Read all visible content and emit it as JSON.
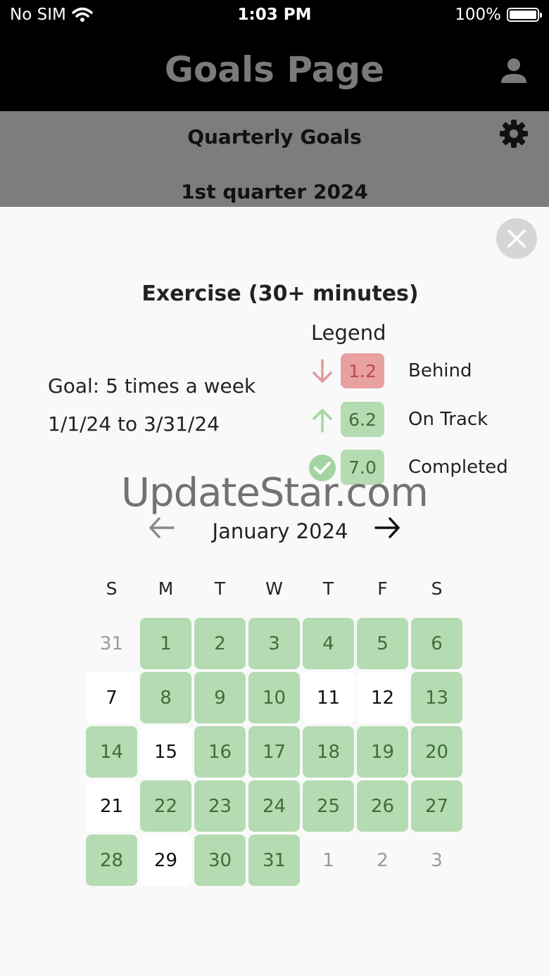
{
  "status_bar": {
    "carrier": "No SIM",
    "time": "1:03 PM",
    "battery": "100%"
  },
  "app_bar": {
    "title": "Goals Page",
    "profile_icon": "person-icon"
  },
  "background": {
    "title": "Quarterly Goals",
    "subtitle": "1st quarter 2024",
    "settings_icon": "gear-icon"
  },
  "sheet": {
    "title": "Exercise (30+ minutes)",
    "goal_text": "Goal: 5 times a week",
    "date_range": "1/1/24 to 3/31/24",
    "legend": {
      "title": "Legend",
      "items": [
        {
          "icon": "arrow-down-icon",
          "value": "1.2",
          "label": "Behind",
          "box_color": "#e8a0a0",
          "text_color": "#b94a4a",
          "icon_color": "#e39a9a"
        },
        {
          "icon": "arrow-up-icon",
          "value": "6.2",
          "label": "On Track",
          "box_color": "#b4dbb1",
          "text_color": "#3f6e3a",
          "icon_color": "#a5d3a1"
        },
        {
          "icon": "check-circle-icon",
          "value": "7.0",
          "label": "Completed",
          "box_color": "#b4dbb1",
          "text_color": "#3f6e3a",
          "icon_color": "#a5d3a1"
        }
      ]
    },
    "watermark": "UpdateStar.com",
    "calendar": {
      "month": "January 2024",
      "weekdays": [
        "S",
        "M",
        "T",
        "W",
        "T",
        "F",
        "S"
      ],
      "weeks": [
        [
          {
            "d": "31",
            "s": "other"
          },
          {
            "d": "1",
            "s": "completed"
          },
          {
            "d": "2",
            "s": "completed"
          },
          {
            "d": "3",
            "s": "completed"
          },
          {
            "d": "4",
            "s": "completed"
          },
          {
            "d": "5",
            "s": "completed"
          },
          {
            "d": "6",
            "s": "completed"
          }
        ],
        [
          {
            "d": "7",
            "s": "plain"
          },
          {
            "d": "8",
            "s": "completed"
          },
          {
            "d": "9",
            "s": "completed"
          },
          {
            "d": "10",
            "s": "completed"
          },
          {
            "d": "11",
            "s": "plain"
          },
          {
            "d": "12",
            "s": "plain"
          },
          {
            "d": "13",
            "s": "completed"
          }
        ],
        [
          {
            "d": "14",
            "s": "completed"
          },
          {
            "d": "15",
            "s": "plain"
          },
          {
            "d": "16",
            "s": "completed"
          },
          {
            "d": "17",
            "s": "completed"
          },
          {
            "d": "18",
            "s": "completed"
          },
          {
            "d": "19",
            "s": "completed"
          },
          {
            "d": "20",
            "s": "completed"
          }
        ],
        [
          {
            "d": "21",
            "s": "plain"
          },
          {
            "d": "22",
            "s": "completed"
          },
          {
            "d": "23",
            "s": "completed"
          },
          {
            "d": "24",
            "s": "completed"
          },
          {
            "d": "25",
            "s": "completed"
          },
          {
            "d": "26",
            "s": "completed"
          },
          {
            "d": "27",
            "s": "completed"
          }
        ],
        [
          {
            "d": "28",
            "s": "completed"
          },
          {
            "d": "29",
            "s": "plain"
          },
          {
            "d": "30",
            "s": "completed"
          },
          {
            "d": "31",
            "s": "completed"
          },
          {
            "d": "1",
            "s": "other"
          },
          {
            "d": "2",
            "s": "other"
          },
          {
            "d": "3",
            "s": "other"
          }
        ]
      ]
    }
  },
  "colors": {
    "completed_bg": "#b4dbb1",
    "completed_text": "#3f6e3a",
    "appbar_bg": "#000000"
  }
}
